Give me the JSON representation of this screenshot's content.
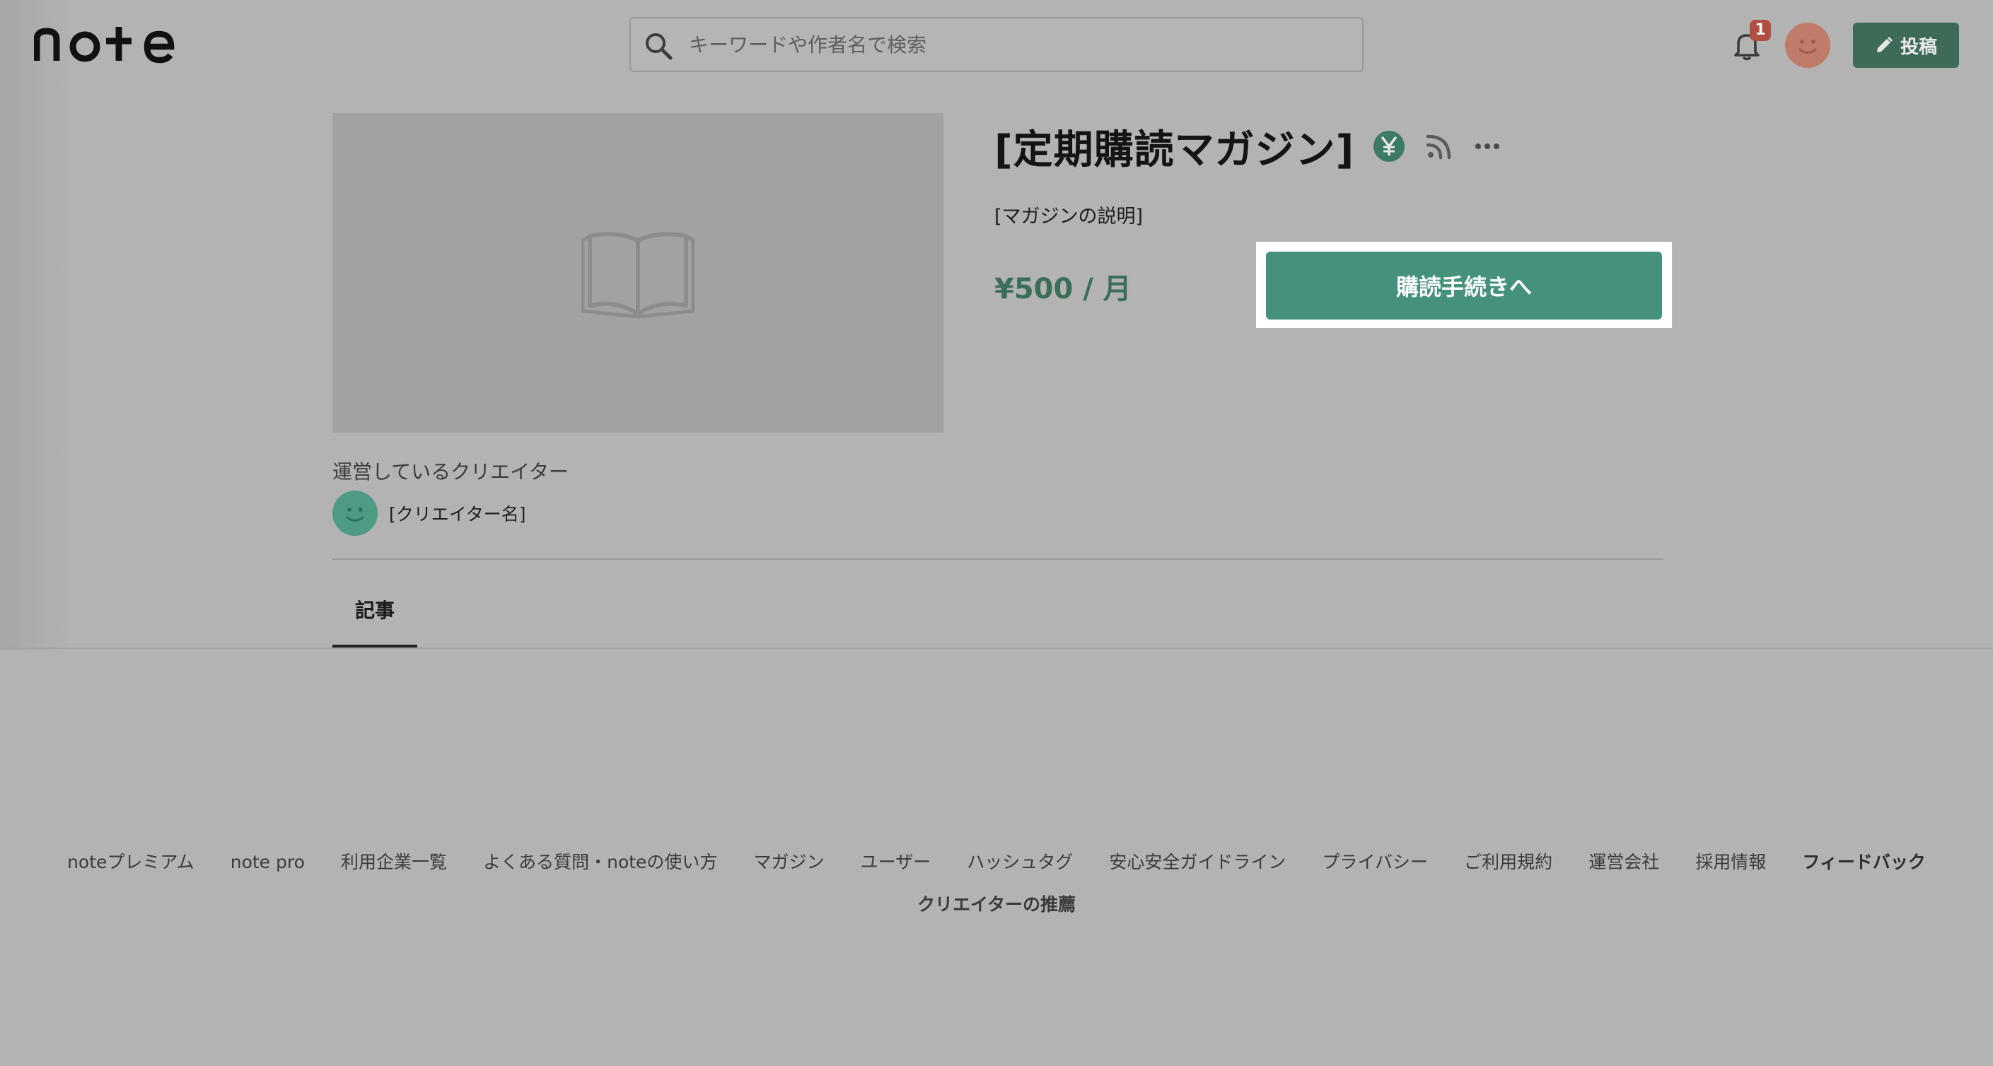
{
  "header": {
    "logo_text": "note",
    "search": {
      "placeholder": "キーワードや作者名で検索",
      "value": ""
    },
    "notification_count": "1",
    "post_label": "投稿"
  },
  "magazine": {
    "title": "[定期購読マガジン]",
    "description": "[マガジンの説明]",
    "price": "¥500 / 月",
    "subscribe_label": "購読手続きへ",
    "creator_heading": "運営しているクリエイター",
    "creator_name": "[クリエイター名]"
  },
  "tabs": [
    {
      "label": "記事",
      "active": true
    }
  ],
  "footer": {
    "links": [
      "noteプレミアム",
      "note pro",
      "利用企業一覧",
      "よくある質問・noteの使い方",
      "マガジン",
      "ユーザー",
      "ハッシュタグ",
      "安心安全ガイドライン",
      "プライバシー",
      "ご利用規約",
      "運営会社",
      "採用情報"
    ],
    "feedback": "フィードバック",
    "creator_recommend": "クリエイターの推薦"
  },
  "colors": {
    "brand_green": "#46917b",
    "overlay_background": "#b3b3b3",
    "notification_red": "#b04e42"
  },
  "icons": {
    "search": "search-icon",
    "bell": "bell-icon",
    "pencil": "pencil-icon",
    "yen": "yen-badge-icon",
    "rss": "rss-icon",
    "more": "more-icon",
    "book": "book-icon"
  }
}
